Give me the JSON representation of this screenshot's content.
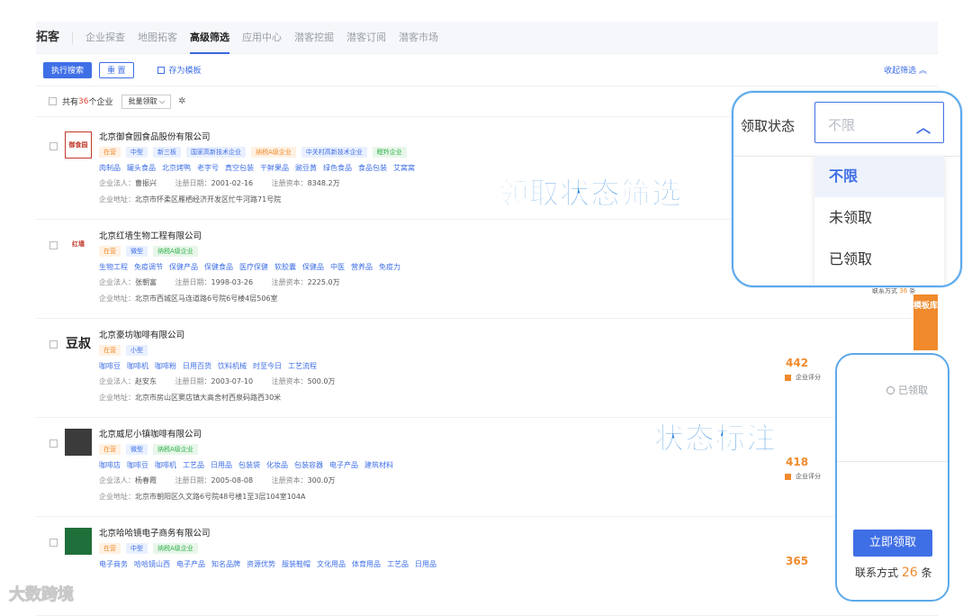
{
  "topnav": {
    "brand": "拓客",
    "tabs": [
      "企业探查",
      "地图拓客",
      "高级筛选",
      "应用中心",
      "潜客挖掘",
      "潜客订阅",
      "潜客市场"
    ],
    "active_tab": "高级筛选"
  },
  "toolbar": {
    "execute_label": "执行搜索",
    "reset_label": "重 置",
    "save_template_label": "存为模板",
    "collapse_label": "收起筛选"
  },
  "listbar": {
    "prefix": "共有",
    "count": "36",
    "suffix": "个企业",
    "batch_label": "批量领取"
  },
  "companies": [
    {
      "name": "北京御食园食品股份有限公司",
      "logo_text": "御食园",
      "tags": [
        {
          "text": "在营",
          "color": "orange"
        },
        {
          "text": "中型",
          "color": "blue"
        },
        {
          "text": "新三板",
          "color": "blue"
        },
        {
          "text": "国家高新技术企业",
          "color": "blue"
        },
        {
          "text": "纳税A级企业",
          "color": "orange"
        },
        {
          "text": "中关村高新技术企业",
          "color": "blue"
        },
        {
          "text": "瞪羚企业",
          "color": "green"
        }
      ],
      "keywords": [
        "肉制品",
        "罐头食品",
        "北京烤鸭",
        "老字号",
        "真空包装",
        "干鲜果品",
        "豌豆黄",
        "绿色食品",
        "食品包装",
        "艾窝窝"
      ],
      "legal_label": "企业法人：",
      "legal": "曹振兴",
      "date_label": "注册日期：",
      "date": "2001-02-16",
      "capital_label": "注册资本：",
      "capital": "8348.2万",
      "addr_label": "企业地址：",
      "address": "北京市怀柔区雁栖经济开发区忙牛河路71号院"
    },
    {
      "name": "北京红墙生物工程有限公司",
      "logo_text": "红墙",
      "tags": [
        {
          "text": "在营",
          "color": "orange"
        },
        {
          "text": "微型",
          "color": "blue"
        },
        {
          "text": "纳税A级企业",
          "color": "green"
        }
      ],
      "keywords": [
        "生物工程",
        "免疫调节",
        "保健产品",
        "保健食品",
        "医疗保健",
        "软胶囊",
        "保健品",
        "中医",
        "营养品",
        "免疫力"
      ],
      "legal_label": "企业法人：",
      "legal": "张朝富",
      "date_label": "注册日期：",
      "date": "1998-03-26",
      "capital_label": "注册资本：",
      "capital": "2225.0万",
      "addr_label": "企业地址：",
      "address": "北京市西城区马连道路6号院6号楼4层506室"
    },
    {
      "name": "北京豪坊咖啡有限公司",
      "logo_text": "豆叔",
      "tags": [
        {
          "text": "在营",
          "color": "orange"
        },
        {
          "text": "小型",
          "color": "blue"
        }
      ],
      "keywords": [
        "咖啡豆",
        "咖啡机",
        "咖啡粉",
        "日用百货",
        "饮料机械",
        "时至今日",
        "工艺流程"
      ],
      "legal_label": "企业法人：",
      "legal": "赵安东",
      "date_label": "注册日期：",
      "date": "2003-07-10",
      "capital_label": "注册资本：",
      "capital": "500.0万",
      "addr_label": "企业地址：",
      "address": "北京市房山区窦店镇大高舍村西泉码路西30米",
      "score": "442",
      "score_label": "企业评分"
    },
    {
      "name": "北京威尼小镇咖啡有限公司",
      "logo_text": "",
      "tags": [
        {
          "text": "在营",
          "color": "orange"
        },
        {
          "text": "微型",
          "color": "blue"
        },
        {
          "text": "纳税A级企业",
          "color": "green"
        }
      ],
      "keywords": [
        "咖啡店",
        "咖啡豆",
        "咖啡机",
        "工艺品",
        "日用品",
        "包装袋",
        "化妆品",
        "包装容器",
        "电子产品",
        "建筑材料"
      ],
      "legal_label": "企业法人：",
      "legal": "杨春霞",
      "date_label": "注册日期：",
      "date": "2005-08-08",
      "capital_label": "注册资本：",
      "capital": "300.0万",
      "addr_label": "企业地址：",
      "address": "北京市朝阳区久文路6号院48号楼1至3层104室104A",
      "score": "418",
      "score_label": "企业评分"
    },
    {
      "name": "北京哈哈镜电子商务有限公司",
      "logo_text": "",
      "tags": [
        {
          "text": "在营",
          "color": "orange"
        },
        {
          "text": "中型",
          "color": "blue"
        },
        {
          "text": "纳税A级企业",
          "color": "green"
        }
      ],
      "keywords": [
        "电子商务",
        "哈哈镜山西",
        "电子产品",
        "知名品牌",
        "资源优势",
        "服装鞋帽",
        "文化用品",
        "体育用品",
        "工艺品",
        "日用品"
      ],
      "score": "365"
    }
  ],
  "side_tab": {
    "text": "模板库"
  },
  "contact_small": {
    "prefix": "联系方式",
    "count": "36",
    "suffix": "条"
  },
  "dropdown_callout": {
    "label": "领取状态",
    "value": "不限",
    "options": [
      "不限",
      "未领取",
      "已领取"
    ],
    "selected": "不限"
  },
  "status_callout": {
    "claimed_label": "已领取",
    "claim_button": "立即领取",
    "contact_prefix": "联系方式",
    "contact_count": "26",
    "contact_suffix": "条"
  },
  "overlays": {
    "filter_title": "领取状态筛选",
    "status_title": "状态标注"
  },
  "watermark": "大数跨境",
  "colors": {
    "primary": "#3f6fe6",
    "accent_orange": "#f08a2c",
    "callout_border": "#5da9ea",
    "overlay_text": "#1f7fd8"
  }
}
